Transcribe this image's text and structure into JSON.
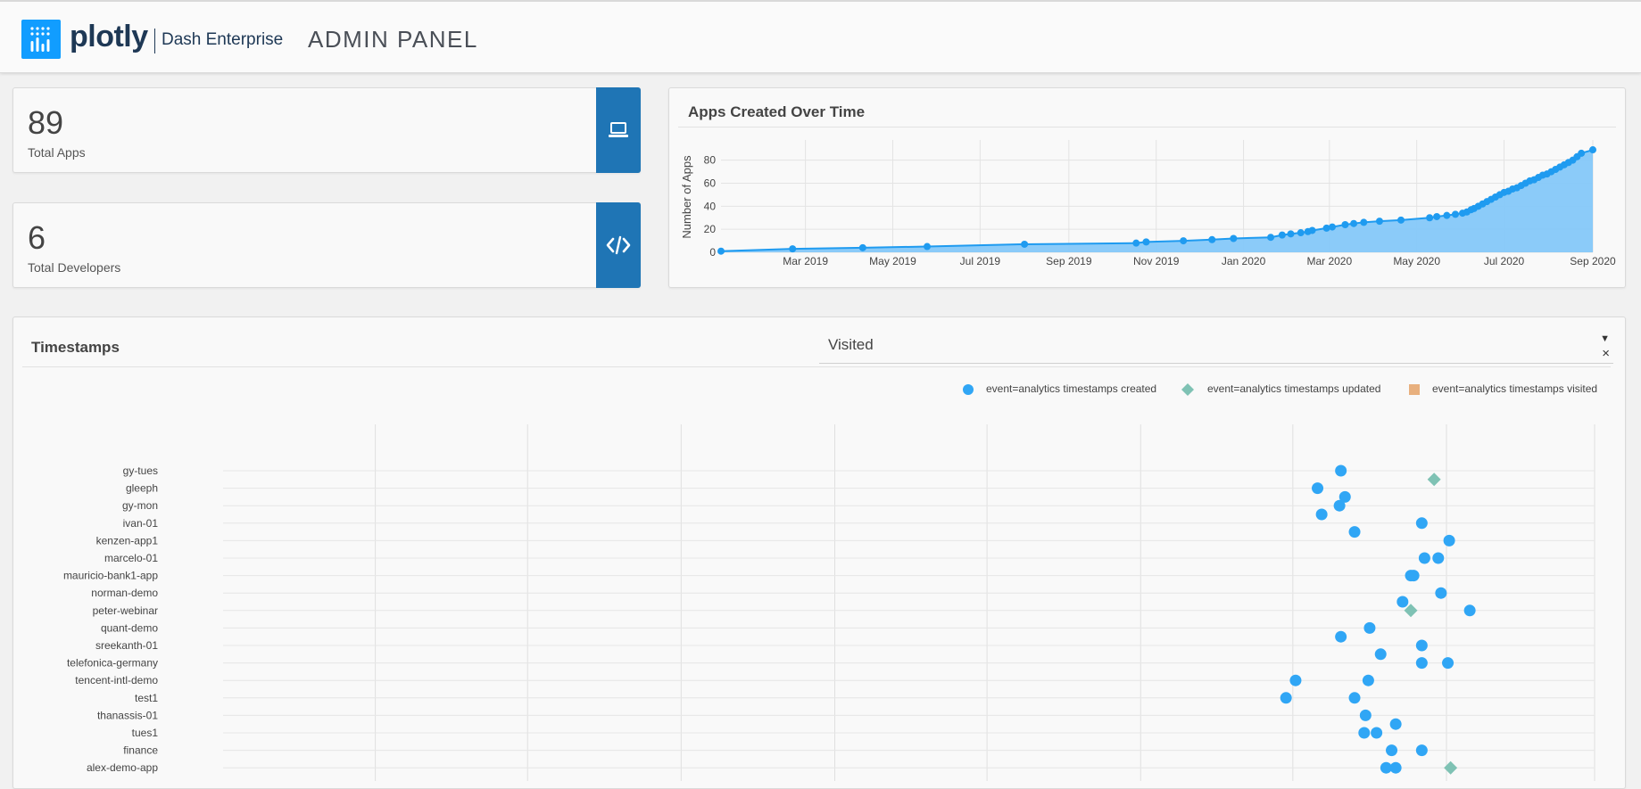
{
  "header": {
    "logo_word": "plotly",
    "logo_sub": "Dash Enterprise",
    "title": "ADMIN PANEL"
  },
  "stats": {
    "apps": {
      "value": "89",
      "label": "Total Apps",
      "icon": "laptop-icon"
    },
    "developers": {
      "value": "6",
      "label": "Total Developers",
      "icon": "code-icon"
    }
  },
  "apps_chart": {
    "title": "Apps Created Over Time"
  },
  "timestamps": {
    "title": "Timestamps",
    "dropdown_value": "Visited",
    "dropdown_arrow": "▼",
    "dropdown_clear": "×"
  },
  "colors": {
    "accent": "#119dff",
    "side_panel": "#1f75b5",
    "created": "#30a6f5",
    "updated": "#7fc2b4",
    "visited": "#e8b07e",
    "area_fill": "#85c8f9"
  },
  "chart_data": [
    {
      "type": "area",
      "title": "Apps Created Over Time",
      "xlabel": "",
      "ylabel": "Number of Apps",
      "x_tick_labels": [
        "Mar 2019",
        "May 2019",
        "Jul 2019",
        "Sep 2019",
        "Nov 2019",
        "Jan 2020",
        "Mar 2020",
        "May 2020",
        "Jul 2020",
        "Sep 2020"
      ],
      "x_range": [
        "2019-01-01",
        "2020-09-01"
      ],
      "ylim": [
        0,
        96
      ],
      "y_ticks": [
        0,
        20,
        40,
        60,
        80
      ],
      "grid": true,
      "x": [
        "2019-01-01",
        "2019-02-20",
        "2019-04-10",
        "2019-05-25",
        "2019-08-01",
        "2019-10-18",
        "2019-10-25",
        "2019-11-20",
        "2019-12-10",
        "2019-12-25",
        "2020-01-20",
        "2020-01-28",
        "2020-02-03",
        "2020-02-10",
        "2020-02-15",
        "2020-02-18",
        "2020-02-28",
        "2020-03-03",
        "2020-03-12",
        "2020-03-18",
        "2020-03-25",
        "2020-04-05",
        "2020-04-20",
        "2020-05-10",
        "2020-05-15",
        "2020-05-22",
        "2020-05-28",
        "2020-06-02",
        "2020-06-05",
        "2020-06-08",
        "2020-06-10",
        "2020-06-13",
        "2020-06-16",
        "2020-06-19",
        "2020-06-22",
        "2020-06-25",
        "2020-06-28",
        "2020-07-01",
        "2020-07-04",
        "2020-07-07",
        "2020-07-10",
        "2020-07-13",
        "2020-07-16",
        "2020-07-19",
        "2020-07-22",
        "2020-07-25",
        "2020-07-28",
        "2020-07-31",
        "2020-08-03",
        "2020-08-06",
        "2020-08-09",
        "2020-08-12",
        "2020-08-15",
        "2020-08-18",
        "2020-08-21",
        "2020-08-24",
        "2020-09-01"
      ],
      "values": [
        1,
        3,
        4,
        5,
        7,
        8,
        9,
        10,
        11,
        12,
        13,
        15,
        16,
        17,
        18,
        19,
        21,
        22,
        24,
        25,
        26,
        27,
        28,
        30,
        31,
        32,
        33,
        34,
        35,
        37,
        38,
        40,
        42,
        44,
        46,
        48,
        50,
        52,
        53,
        55,
        56,
        58,
        60,
        62,
        63,
        65,
        67,
        68,
        70,
        72,
        74,
        76,
        78,
        80,
        83,
        86,
        89
      ]
    },
    {
      "type": "scatter",
      "title": "Timestamps",
      "series_order": [
        "created",
        "updated",
        "visited"
      ],
      "series": [
        {
          "name": "event=analytics timestamps created",
          "key": "created",
          "marker": "circle"
        },
        {
          "name": "event=analytics timestamps updated",
          "key": "updated",
          "marker": "diamond"
        },
        {
          "name": "event=analytics timestamps visited",
          "key": "visited",
          "marker": "square"
        }
      ],
      "categories": [
        "gy-tues",
        "gleeph",
        "gy-mon",
        "ivan-01",
        "kenzen-app1",
        "marcelo-01",
        "mauricio-bank1-app",
        "norman-demo",
        "peter-webinar",
        "quant-demo",
        "sreekanth-01",
        "telefonica-germany",
        "tencent-intl-demo",
        "test1",
        "thanassis-01",
        "tues1",
        "finance",
        "alex-demo-app"
      ],
      "x_range": [
        0,
        100
      ],
      "x_gridlines": [
        11.1,
        22.2,
        33.4,
        44.6,
        55.7,
        66.9,
        78.0,
        89.2,
        100
      ],
      "points": [
        {
          "series": "created",
          "x": 81.5,
          "cat": 0,
          "offset": 0
        },
        {
          "series": "updated",
          "x": 88.3,
          "cat": 0,
          "offset": 0.5
        },
        {
          "series": "created",
          "x": 79.8,
          "cat": 1,
          "offset": 0
        },
        {
          "series": "created",
          "x": 81.8,
          "cat": 1,
          "offset": 0.5
        },
        {
          "series": "created",
          "x": 81.4,
          "cat": 2,
          "offset": 0
        },
        {
          "series": "created",
          "x": 80.1,
          "cat": 2,
          "offset": 0.5
        },
        {
          "series": "created",
          "x": 87.4,
          "cat": 3,
          "offset": 0
        },
        {
          "series": "created",
          "x": 82.5,
          "cat": 3,
          "offset": 0.5
        },
        {
          "series": "created",
          "x": 89.4,
          "cat": 4,
          "offset": 0
        },
        {
          "series": "created",
          "x": 87.6,
          "cat": 5,
          "offset": 0
        },
        {
          "series": "created",
          "x": 88.6,
          "cat": 5,
          "offset": 0
        },
        {
          "series": "created",
          "x": 86.6,
          "cat": 6,
          "offset": 0
        },
        {
          "series": "created",
          "x": 86.8,
          "cat": 6,
          "offset": 0
        },
        {
          "series": "created",
          "x": 88.8,
          "cat": 7,
          "offset": 0
        },
        {
          "series": "created",
          "x": 86.0,
          "cat": 7,
          "offset": 0.5
        },
        {
          "series": "created",
          "x": 90.9,
          "cat": 8,
          "offset": 0
        },
        {
          "series": "updated",
          "x": 86.6,
          "cat": 8,
          "offset": 0
        },
        {
          "series": "created",
          "x": 83.6,
          "cat": 9,
          "offset": 0
        },
        {
          "series": "created",
          "x": 81.5,
          "cat": 9,
          "offset": 0.5
        },
        {
          "series": "created",
          "x": 87.4,
          "cat": 10,
          "offset": 0
        },
        {
          "series": "created",
          "x": 84.4,
          "cat": 10,
          "offset": 0.5
        },
        {
          "series": "created",
          "x": 87.4,
          "cat": 11,
          "offset": 0
        },
        {
          "series": "created",
          "x": 89.3,
          "cat": 11,
          "offset": 0
        },
        {
          "series": "created",
          "x": 83.5,
          "cat": 12,
          "offset": 0
        },
        {
          "series": "created",
          "x": 78.2,
          "cat": 12,
          "offset": 0
        },
        {
          "series": "created",
          "x": 77.5,
          "cat": 13,
          "offset": 0
        },
        {
          "series": "created",
          "x": 82.5,
          "cat": 13,
          "offset": 0
        },
        {
          "series": "created",
          "x": 83.3,
          "cat": 14,
          "offset": 0
        },
        {
          "series": "created",
          "x": 85.5,
          "cat": 14,
          "offset": 0.5
        },
        {
          "series": "created",
          "x": 84.1,
          "cat": 15,
          "offset": 0
        },
        {
          "series": "created",
          "x": 83.2,
          "cat": 15,
          "offset": 0
        },
        {
          "series": "created",
          "x": 87.4,
          "cat": 16,
          "offset": 0
        },
        {
          "series": "created",
          "x": 85.2,
          "cat": 16,
          "offset": 0
        },
        {
          "series": "created",
          "x": 85.5,
          "cat": 17,
          "offset": 0
        },
        {
          "series": "created",
          "x": 84.8,
          "cat": 17,
          "offset": 0
        },
        {
          "series": "updated",
          "x": 89.5,
          "cat": 17,
          "offset": 0
        }
      ]
    }
  ]
}
